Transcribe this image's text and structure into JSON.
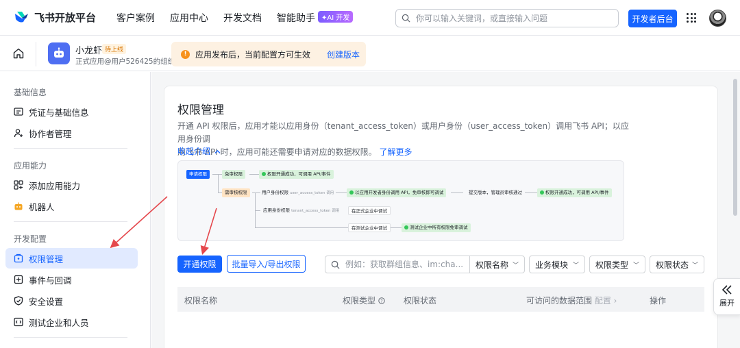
{
  "topnav": {
    "brand": "飞书开放平台",
    "links": [
      "客户案例",
      "应用中心",
      "开发文档",
      "智能助手"
    ],
    "ai_badge": "✦AI 开发",
    "search_placeholder": "你可以输入关键词，或直接输入问题",
    "dev_console": "开发者后台",
    "brand_color": "#1664ff"
  },
  "appbar": {
    "app_name": "小龙虾",
    "app_status": "待上线",
    "app_org": "正式应用@用户526425的组织",
    "notice_text": "应用发布后，当前配置方可生效",
    "notice_link": "创建版本"
  },
  "sidebar": {
    "sections": [
      {
        "title": "基础信息",
        "items": [
          {
            "label": "凭证与基础信息",
            "icon": "credential-icon"
          },
          {
            "label": "协作者管理",
            "icon": "collaborator-icon"
          }
        ]
      },
      {
        "title": "应用能力",
        "items": [
          {
            "label": "添加应用能力",
            "icon": "add-capability-icon"
          },
          {
            "label": "机器人",
            "icon": "robot-icon"
          }
        ]
      },
      {
        "title": "开发配置",
        "items": [
          {
            "label": "权限管理",
            "icon": "permission-icon",
            "active": true
          },
          {
            "label": "事件与回调",
            "icon": "event-icon"
          },
          {
            "label": "安全设置",
            "icon": "shield-icon"
          },
          {
            "label": "测试企业和人员",
            "icon": "code-icon"
          }
        ]
      }
    ]
  },
  "main": {
    "title": "权限管理",
    "desc_line1": "开通 API 权限后，应用才能以应用身份（tenant_access_token）或用户身份（user_access_token）调用飞书 API；以应用身份调",
    "desc_line2": "用飞书 API 时，应用可能还需要申请对应的数据权限。",
    "learn_more": "了解更多",
    "collapse": "收起介绍"
  },
  "flow": {
    "apply": "申请权限",
    "no_review": "免审权限",
    "no_review_result": "权限开通成功，可调用 API/事件",
    "review": "需审核权限",
    "user_identity": "用户身份权限",
    "user_token": "user_access_token 调用",
    "user_step": "以应用开发者身份调用 API，免审核即可调试",
    "submit": "提交版本，管理员审核通过",
    "final_result": "权限开通成功，可调用 API/事件",
    "app_identity": "应用身份权限",
    "app_token": "tenant_access_token 调用",
    "prod_debug": "在正式企业中调试",
    "test_debug": "在测试企业中调试",
    "test_result": "测试企业中所有权限免审调试"
  },
  "toolbar": {
    "enable_btn": "开通权限",
    "batch_btn": "批量导入/导出权限",
    "search_placeholder": "例如：获取群组信息、im:cha...",
    "filters": [
      "权限名称",
      "业务模块",
      "权限类型",
      "权限状态"
    ]
  },
  "table": {
    "columns": [
      "权限名称",
      "权限类型",
      "权限状态",
      "可访问的数据范围",
      "配置",
      "操作"
    ]
  },
  "expand_label": "展开",
  "annotation_color": "#e5484d"
}
